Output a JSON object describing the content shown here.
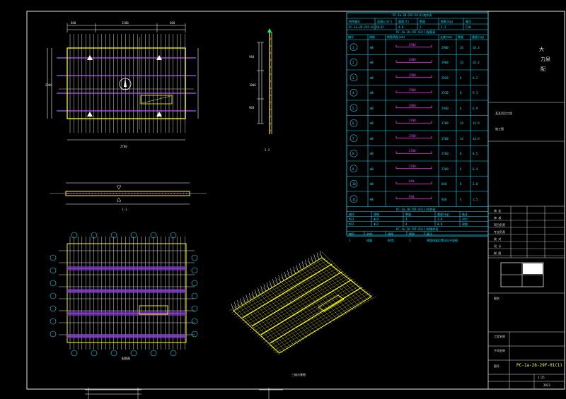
{
  "title_block": {
    "company_lines": [
      "大",
      "力泉",
      "配"
    ],
    "project_label": "某某项目工程",
    "drawing_no": "PC-1a-28-29F-01(1)",
    "scale": "1:25",
    "sheet": "2023",
    "rows": [
      "审 定",
      "审 核",
      "项目负责",
      "专业负责",
      "校 对",
      "设 计",
      "制 图"
    ],
    "left_labels": [
      "图名",
      "工程名称",
      "子项名称",
      "图号"
    ],
    "status": "施工图"
  },
  "table": {
    "header1": "PC-1a-28-29F-01(1)构件表",
    "cols1": [
      "构件编号",
      "混凝土(m³)",
      "重量(t)",
      "数量",
      "钢筋(kg)",
      "备注"
    ],
    "row1": [
      "PC-1a-28-29F-01(1)",
      "1.62",
      "4.0",
      "2",
      "2.3",
      "C30"
    ],
    "header2": "PC-1a-28-29F-01(1)配筋表",
    "cols2": [
      "编号",
      "规格",
      "钢筋简图(mm)",
      "长度(mm)",
      "数量",
      "重量(kg)"
    ],
    "rows2": [
      [
        "1",
        "Φ8",
        "2900",
        "2900",
        "16",
        "18.3"
      ],
      [
        "2",
        "Φ8",
        "2900",
        "2900",
        "16",
        "18.3"
      ],
      [
        "3",
        "Φ8",
        "2900",
        "2920",
        "8",
        "9.2"
      ],
      [
        "4",
        "Φ8",
        "2900",
        "2930",
        "8",
        "9.3"
      ],
      [
        "5",
        "Φ8",
        "2900",
        "2940",
        "6",
        "6.9"
      ],
      [
        "6",
        "Φ8",
        "2700",
        "2700",
        "14",
        "14.9"
      ],
      [
        "7",
        "Φ8",
        "2700",
        "2700",
        "14",
        "14.9"
      ],
      [
        "8",
        "Φ8",
        "2700",
        "2700",
        "8",
        "8.5"
      ],
      [
        "9",
        "Φ8",
        "2700",
        "2700",
        "6",
        "6.4"
      ],
      [
        "10",
        "Φ8",
        "640",
        "640",
        "8",
        "2.0"
      ],
      [
        "11",
        "Φ8",
        "940",
        "940",
        "4",
        "1.5"
      ]
    ],
    "header3": "PC-1a-28-29F-01(1)吊件表",
    "cols3": [
      "编号",
      "规格",
      "数量",
      "重量(kg)",
      "备注"
    ],
    "rows3": [
      [
        "MJ1",
        "Φ14",
        "4",
        "1.0",
        "吊钉"
      ],
      [
        "MJ2",
        "Φ12",
        "4",
        "0.8",
        "预埋"
      ]
    ],
    "header4": "PC-1a-28-29F-01(1)预埋件表",
    "cols4": [
      "编号",
      "名称",
      "规格",
      "数量",
      "备注"
    ],
    "row4": [
      "1",
      "线盒",
      "86型",
      "1",
      "预埋线盒位置详见平面图"
    ]
  },
  "labels": {
    "plan_width": "2700",
    "plan_height": "2900",
    "section_1": "1-1",
    "section_2": "2-2",
    "rebar_plan": "配筋图",
    "iso_view": "三维示意图",
    "dims_top": [
      "600",
      "1500",
      "600"
    ],
    "dims_side": [
      "940",
      "1000",
      "960"
    ]
  }
}
